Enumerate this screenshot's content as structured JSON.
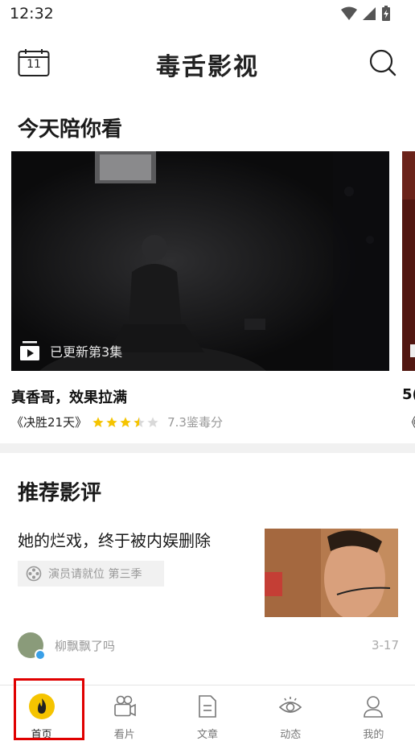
{
  "status": {
    "time": "12:32"
  },
  "header": {
    "calendar_day": "11",
    "app_name": "毒舌影视"
  },
  "today": {
    "section_title": "今天陪你看",
    "cards": [
      {
        "update_text": "已更新第3集",
        "title": "真香哥，效果拉满",
        "show": "《决胜21天》",
        "rating_stars": 3.5,
        "score_text": "7.3鉴毒分"
      },
      {
        "title": "5(",
        "show": "《"
      }
    ]
  },
  "reviews": {
    "section_title": "推荐影评",
    "items": [
      {
        "title": "她的烂戏，终于被内娱删除",
        "tag": "演员请就位 第三季",
        "author": "柳飘飘了吗",
        "date": "3-17"
      }
    ]
  },
  "nav": {
    "items": [
      {
        "label": "首页",
        "icon": "home-flame-icon",
        "active": true
      },
      {
        "label": "看片",
        "icon": "camera-icon",
        "active": false
      },
      {
        "label": "文章",
        "icon": "document-icon",
        "active": false
      },
      {
        "label": "动态",
        "icon": "eye-icon",
        "active": false
      },
      {
        "label": "我的",
        "icon": "profile-icon",
        "active": false
      }
    ]
  },
  "colors": {
    "accent": "#f5c400",
    "highlight": "#e00000",
    "star": "#f5c400"
  }
}
